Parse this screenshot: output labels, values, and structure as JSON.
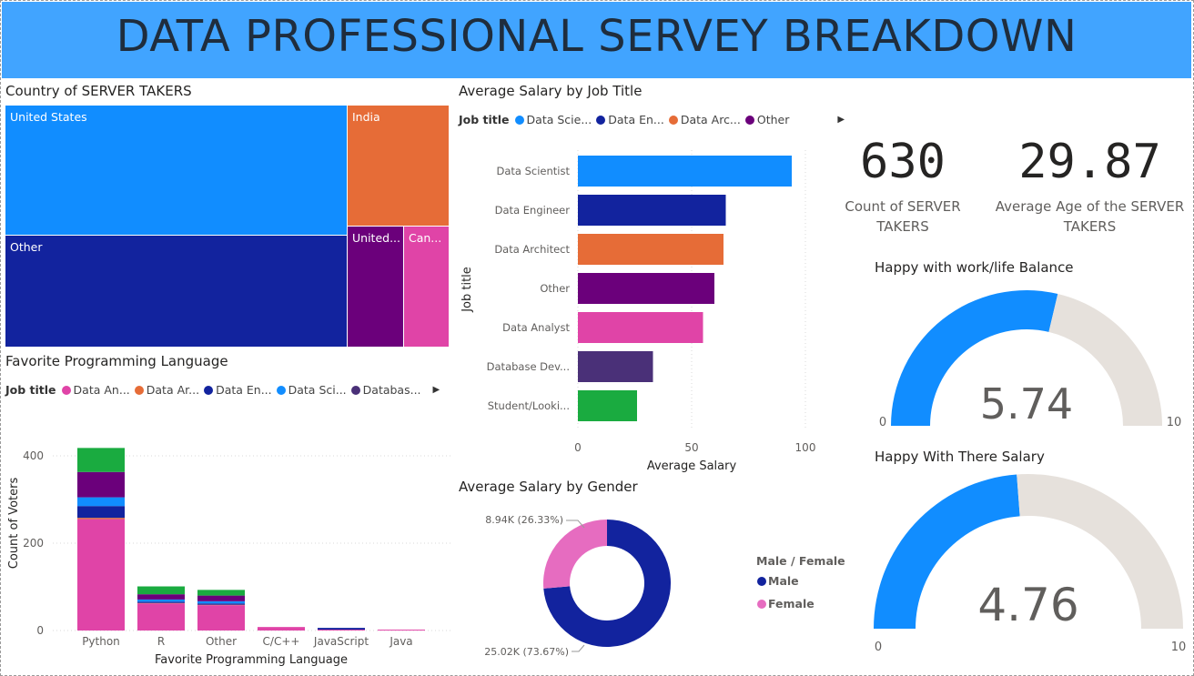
{
  "banner": {
    "title": "DATA PROFESSIONAL SERVEY BREAKDOWN",
    "color": "#41a4ff"
  },
  "treemap": {
    "title": "Country of SERVER TAKERS",
    "cells": [
      {
        "label": "United States",
        "color": "#118dff"
      },
      {
        "label": "India",
        "color": "#e66c37"
      },
      {
        "label": "Other",
        "color": "#12239e"
      },
      {
        "label": "United...",
        "color": "#6b007b"
      },
      {
        "label": "Can...",
        "color": "#e044a7"
      }
    ]
  },
  "kpis": [
    {
      "value": "630",
      "label_line1": "Count of SERVER",
      "label_line2": "TAKERS"
    },
    {
      "value": "29.87",
      "label_line1": "Average Age of the SERVER",
      "label_line2": "TAKERS"
    }
  ],
  "gauges": [
    {
      "title": "Happy with work/life Balance",
      "value": 5.74,
      "display": "5.74",
      "min": 0,
      "max": 10,
      "min_label": "0",
      "max_label": "10",
      "fill": "#118dff",
      "track": "#e6e1dc"
    },
    {
      "title": "Happy With There Salary",
      "value": 4.76,
      "display": "4.76",
      "min": 0,
      "max": 10,
      "min_label": "0",
      "max_label": "10",
      "fill": "#118dff",
      "track": "#e6e1dc"
    }
  ],
  "chart_data": [
    {
      "type": "bar",
      "orientation": "horizontal",
      "title": "Average Salary by Job Title",
      "legend_title": "Job title",
      "legend": [
        {
          "label": "Data Scie...",
          "color": "#118dff"
        },
        {
          "label": "Data En...",
          "color": "#12239e"
        },
        {
          "label": "Data Arc...",
          "color": "#e66c37"
        },
        {
          "label": "Other",
          "color": "#6b007b"
        }
      ],
      "legend_placement": "top",
      "categories": [
        "Data Scientist",
        "Data Engineer",
        "Data Architect",
        "Other",
        "Data Analyst",
        "Database Dev...",
        "Student/Looki..."
      ],
      "values": [
        94,
        65,
        64,
        60,
        55,
        33,
        26
      ],
      "colors": [
        "#118dff",
        "#12239e",
        "#e66c37",
        "#6b007b",
        "#e044a7",
        "#4a3078",
        "#1aab40"
      ],
      "xlabel": "Average Salary",
      "ylabel": "Job title",
      "xticks": [
        0,
        50,
        100
      ],
      "xlim": [
        0,
        100
      ],
      "grid": true
    },
    {
      "type": "bar",
      "stacked": true,
      "title": "Favorite Programming Language",
      "legend_title": "Job title",
      "legend": [
        {
          "label": "Data An...",
          "color": "#e044a7"
        },
        {
          "label": "Data Ar...",
          "color": "#e66c37"
        },
        {
          "label": "Data En...",
          "color": "#12239e"
        },
        {
          "label": "Data Sci...",
          "color": "#118dff"
        },
        {
          "label": "Databas...",
          "color": "#4a3078"
        }
      ],
      "legend_placement": "top",
      "categories": [
        "Python",
        "R",
        "Other",
        "C/C++",
        "JavaScript",
        "Java"
      ],
      "series": [
        {
          "name": "Data Analyst",
          "color": "#e044a7",
          "values": [
            255,
            62,
            58,
            8,
            2,
            2
          ]
        },
        {
          "name": "Data Architect",
          "color": "#e66c37",
          "values": [
            3,
            1,
            1,
            0,
            0,
            0
          ]
        },
        {
          "name": "Data Engineer",
          "color": "#12239e",
          "values": [
            27,
            3,
            3,
            0,
            4,
            0
          ]
        },
        {
          "name": "Data Scientist",
          "color": "#118dff",
          "values": [
            20,
            5,
            5,
            0,
            0,
            0
          ]
        },
        {
          "name": "Other",
          "color": "#6b007b",
          "values": [
            58,
            12,
            13,
            0,
            0,
            0
          ]
        },
        {
          "name": "Student/Looking",
          "color": "#1aab40",
          "values": [
            55,
            18,
            13,
            0,
            0,
            0
          ]
        }
      ],
      "xlabel": "Favorite Programming Language",
      "ylabel": "Count of Voters",
      "yticks": [
        0,
        200,
        400
      ],
      "ylim": [
        0,
        440
      ],
      "grid": true
    },
    {
      "type": "pie",
      "donut": true,
      "title": "Average Salary by Gender",
      "legend_title": "Male / Female",
      "legend_placement": "right",
      "slices": [
        {
          "label": "Male",
          "value": 25.02,
          "data_label": "25.02K (73.67%)",
          "color": "#12239e"
        },
        {
          "label": "Female",
          "value": 8.94,
          "data_label": "8.94K (26.33%)",
          "color": "#e66cc0"
        }
      ]
    }
  ]
}
